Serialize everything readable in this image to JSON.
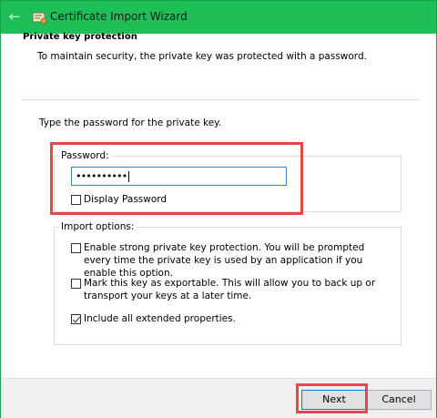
{
  "window": {
    "title": "Certificate Import Wizard"
  },
  "header": {
    "title": "Private key protection",
    "subtitle": "To maintain security, the private key was protected with a password."
  },
  "instruction": "Type the password for the private key.",
  "password_group": {
    "label": "Password:",
    "value": "••••••••••",
    "display_password_label": "Display Password",
    "display_password_checked": false
  },
  "import_options": {
    "label": "Import options:",
    "options": [
      {
        "label": "Enable strong private key protection. You will be prompted every time the private key is used by an application if you enable this option.",
        "checked": false
      },
      {
        "label": "Mark this key as exportable. This will allow you to back up or transport your keys at a later time.",
        "checked": false
      },
      {
        "label": "Include all extended properties.",
        "checked": true
      }
    ]
  },
  "footer": {
    "next_label": "Next",
    "cancel_label": "Cancel"
  },
  "colors": {
    "titlebar": "#1fbf57",
    "highlight": "#e24a4a",
    "focus": "#0078d7"
  }
}
